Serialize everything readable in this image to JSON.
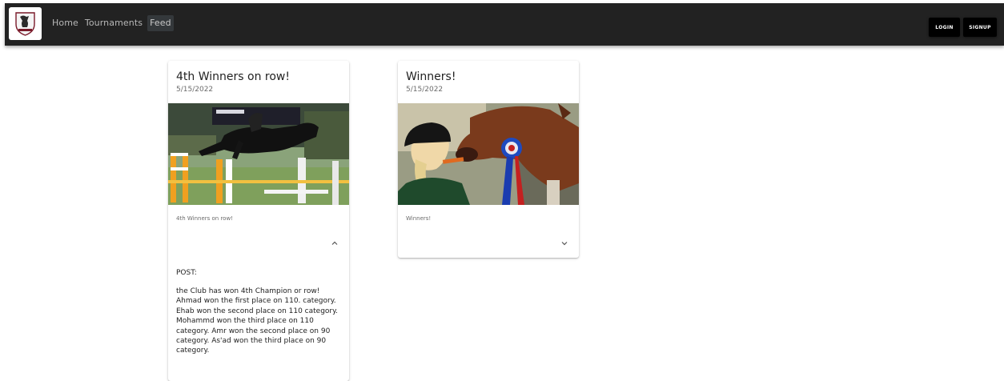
{
  "header": {
    "nav": [
      "Home",
      "Tournaments",
      "Feed"
    ],
    "active_nav": "Feed",
    "login_label": "LOGIN",
    "signup_label": "SIGNUP",
    "bar_color": "#222222"
  },
  "posts": [
    {
      "title": "4th Winners on row!",
      "date": "5/15/2022",
      "summary": "4th Winners on row!",
      "expanded": true,
      "expand_icon": "chevron-up-icon",
      "post_label": "POST:",
      "body": "the Club has won 4th Champion or row! Ahmad won the first place on 110. category. Ehab won the second place on 110 category. Mohammd won the third place on 110 category. Amr won the second place on 90 category. As'ad won the third place on 90 category."
    },
    {
      "title": "Winners!",
      "date": "5/15/2022",
      "summary": "Winners!",
      "expanded": false,
      "expand_icon": "chevron-down-icon"
    }
  ]
}
